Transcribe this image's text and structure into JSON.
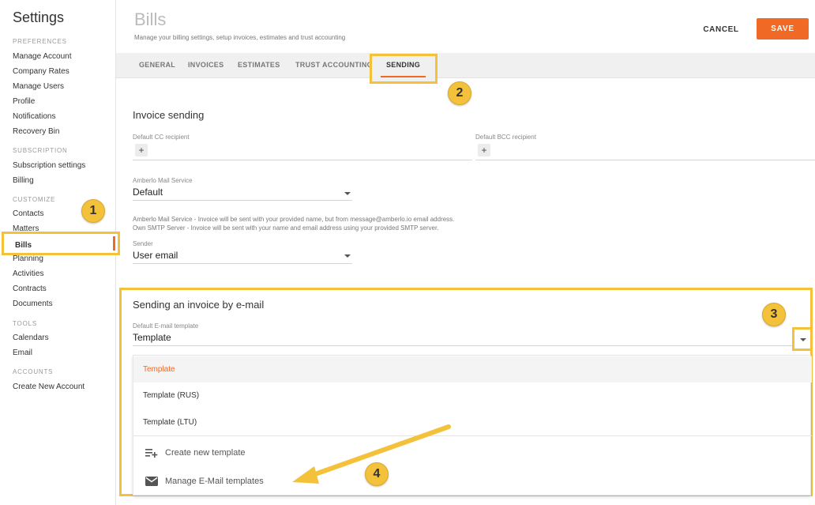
{
  "sidebar": {
    "title": "Settings",
    "sections": [
      {
        "label": "PREFERENCES",
        "items": [
          "Manage Account",
          "Company Rates",
          "Manage Users",
          "Profile",
          "Notifications",
          "Recovery Bin"
        ]
      },
      {
        "label": "SUBSCRIPTION",
        "items": [
          "Subscription settings",
          "Billing"
        ]
      },
      {
        "label": "CUSTOMIZE",
        "items": [
          "Contacts",
          "Matters",
          "Bills",
          "Planning",
          "Activities",
          "Contracts",
          "Documents"
        ]
      },
      {
        "label": "TOOLS",
        "items": [
          "Calendars",
          "Email"
        ]
      },
      {
        "label": "ACCOUNTS",
        "items": [
          "Create New Account"
        ]
      }
    ],
    "active_item": "Bills"
  },
  "header": {
    "title": "Bills",
    "subtitle": "Manage your billing settings, setup invoices, estimates and trust accounting",
    "cancel_label": "CANCEL",
    "save_label": "SAVE"
  },
  "tabs": [
    "GENERAL",
    "INVOICES",
    "ESTIMATES",
    "TRUST ACCOUNTING",
    "SENDING"
  ],
  "active_tab": "SENDING",
  "invoice_sending": {
    "title": "Invoice sending",
    "cc_label": "Default CC recipient",
    "bcc_label": "Default BCC recipient",
    "add_symbol": "+",
    "mail_service_label": "Amberlo Mail Service",
    "mail_service_value": "Default",
    "help_line1": "Amberlo Mail Service - Invoice will be sent with your provided name, but from message@amberlo.io email address.",
    "help_line2": "Own SMTP Server - Invoice will be sent with your name and email address using your provided SMTP server.",
    "sender_label": "Sender",
    "sender_value": "User email"
  },
  "email_sending": {
    "title": "Sending an invoice by e-mail",
    "template_label": "Default E-mail template",
    "template_value": "Template",
    "options": [
      "Template",
      "Template (RUS)",
      "Template (LTU)"
    ],
    "selected_option": "Template",
    "create_label": "Create new template",
    "manage_label": "Manage E-Mail templates"
  },
  "badges": [
    "1",
    "2",
    "3",
    "4"
  ],
  "colors": {
    "accent": "#f06a25",
    "highlight": "#f3c13a"
  }
}
